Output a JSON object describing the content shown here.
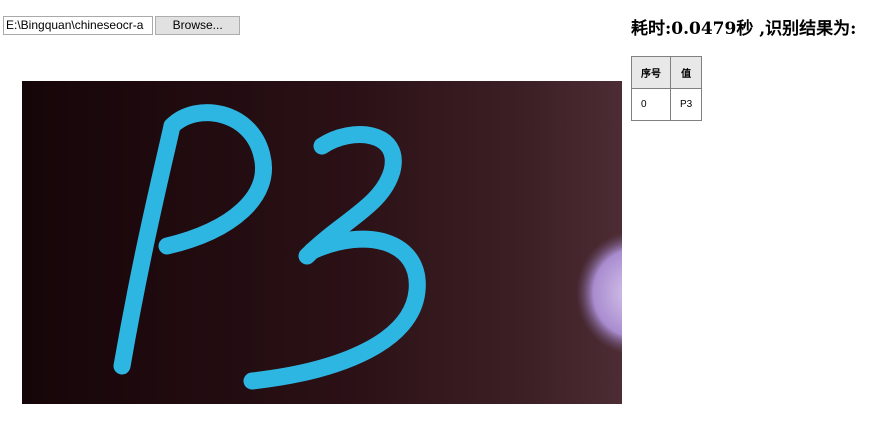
{
  "file_input": {
    "path": "E:\\Bingquan\\chineseocr-a",
    "browse_label": "Browse..."
  },
  "result": {
    "title": "耗时:0.0479秒 ,识别结果为:",
    "table": {
      "headers": [
        "序号",
        "值"
      ],
      "rows": [
        [
          "0",
          "P3"
        ]
      ]
    }
  },
  "image": {
    "text": "P3",
    "background_color": "#2a0f12",
    "stroke_color": "#2eb6e3"
  }
}
